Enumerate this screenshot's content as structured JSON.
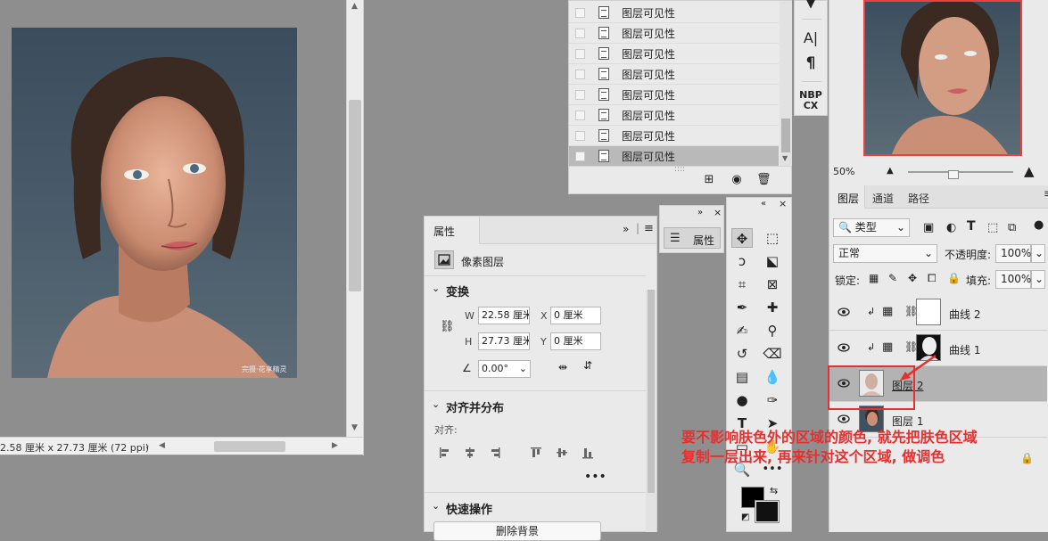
{
  "document": {
    "status_text": "2.58 厘米 x 27.73 厘米 (72 ppi)",
    "watermark": "完摄·花享精灵"
  },
  "history": {
    "items": [
      {
        "label": "图层可见性",
        "selected": false
      },
      {
        "label": "图层可见性",
        "selected": false
      },
      {
        "label": "图层可见性",
        "selected": false
      },
      {
        "label": "图层可见性",
        "selected": false
      },
      {
        "label": "图层可见性",
        "selected": false
      },
      {
        "label": "图层可见性",
        "selected": false
      },
      {
        "label": "图层可见性",
        "selected": false
      },
      {
        "label": "图层可见性",
        "selected": true
      }
    ]
  },
  "char_strip": {
    "char_label": "A|",
    "para_label": "¶",
    "nbp_label": "NBP",
    "cx_label": "CX"
  },
  "navigator": {
    "zoom": "50%"
  },
  "layers": {
    "tabs": [
      "图层",
      "通道",
      "路径"
    ],
    "filter_kind": "类型",
    "blend_mode": "正常",
    "opacity_label": "不透明度:",
    "opacity_value": "100%",
    "lock_label": "锁定:",
    "fill_label": "填充:",
    "fill_value": "100%",
    "items": [
      {
        "name": "曲线 2",
        "type": "curves",
        "selected": false
      },
      {
        "name": "曲线 1",
        "type": "curves",
        "selected": false
      },
      {
        "name": "图层 2",
        "type": "pixel",
        "selected": true
      },
      {
        "name": "图层 1",
        "type": "pixel",
        "selected": false
      }
    ]
  },
  "properties": {
    "tab_label": "属性",
    "layer_type": "像素图层",
    "transform_title": "变换",
    "w_label": "W",
    "w_value": "22.58 厘米",
    "x_label": "X",
    "x_value": "0 厘米",
    "h_label": "H",
    "h_value": "27.73 厘米",
    "y_label": "Y",
    "y_value": "0 厘米",
    "angle_value": "0.00°",
    "align_title": "对齐并分布",
    "align_label": "对齐:",
    "quick_title": "快速操作",
    "quick_button": "删除背景"
  },
  "mini_props": {
    "label": "属性"
  },
  "annotation": {
    "line1": "要不影响肤色外的区域的颜色, 就先把肤色区域",
    "line2": "复制一层出来, 再来针对这个区域, 做调色"
  },
  "colors": {
    "accent_red": "#e53030",
    "panel_bg": "#eaeaea",
    "workspace_bg": "#8f8f8f"
  }
}
